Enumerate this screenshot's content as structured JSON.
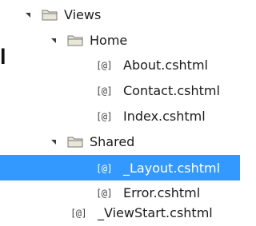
{
  "cropped_text": "l",
  "tree": {
    "views": {
      "label": "Views",
      "icon": "folder-icon"
    },
    "home": {
      "label": "Home",
      "icon": "folder-icon"
    },
    "about": {
      "label": "About.cshtml",
      "glyph": "[@]"
    },
    "contact": {
      "label": "Contact.cshtml",
      "glyph": "[@]"
    },
    "index": {
      "label": "Index.cshtml",
      "glyph": "[@]"
    },
    "shared": {
      "label": "Shared",
      "icon": "folder-icon"
    },
    "layout": {
      "label": "_Layout.cshtml",
      "glyph": "[@]",
      "selected": true
    },
    "error": {
      "label": "Error.cshtml",
      "glyph": "[@]"
    },
    "viewstart": {
      "label": "_ViewStart.cshtml",
      "glyph": "[@]"
    }
  },
  "colors": {
    "selection": "#3399ff",
    "folder_fill": "#e8e6d8",
    "folder_stroke": "#7a7a7a",
    "text": "#1b1b1b"
  }
}
